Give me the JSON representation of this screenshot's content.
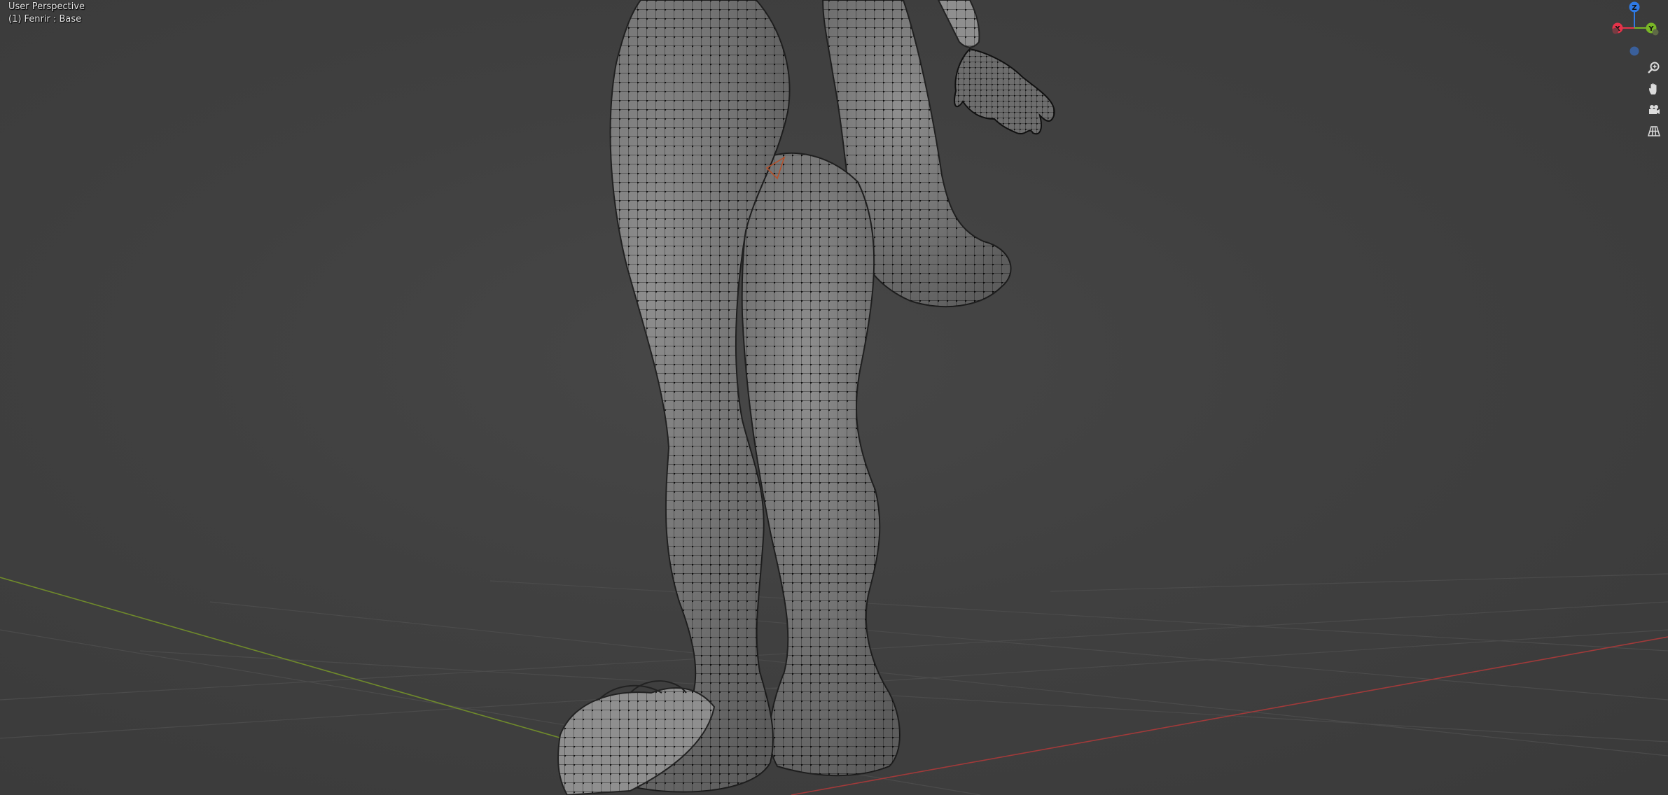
{
  "viewport": {
    "mode_label": "User Perspective",
    "object_label": "(1) Fenrir : Base"
  },
  "gizmo": {
    "axes": [
      {
        "label": "Z",
        "color": "#2f7ae5"
      },
      {
        "label": "Y",
        "color": "#79b626"
      },
      {
        "label": "X",
        "color": "#e5334a"
      }
    ]
  },
  "colors": {
    "background": "#3d3d3d",
    "grid_line": "#4a4a4a",
    "x_axis": "#a13a3a",
    "y_axis": "#6f8a2b",
    "mesh_fill": "#8c8c8c",
    "mesh_wire": "#1a1a1a"
  },
  "nav_buttons": [
    {
      "name": "zoom-icon"
    },
    {
      "name": "pan-hand-icon"
    },
    {
      "name": "camera-icon"
    },
    {
      "name": "ortho-grid-icon"
    }
  ]
}
